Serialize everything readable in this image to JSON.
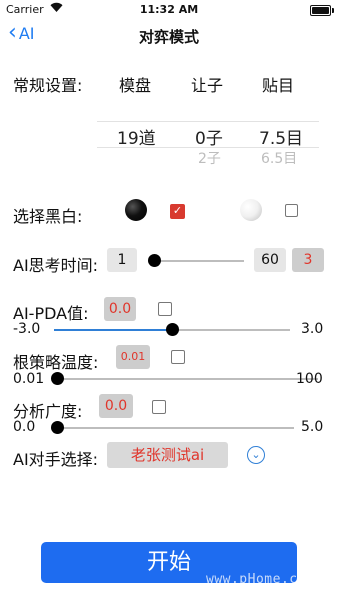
{
  "status_bar": {
    "carrier": "Carrier",
    "time": "11:32 AM"
  },
  "nav": {
    "back_label": "AI",
    "title": "对弈模式"
  },
  "general": {
    "label": "常规设置:",
    "headers": [
      "模盘",
      "让子",
      "贴目"
    ],
    "selected": [
      "19道",
      "0子",
      "7.5目"
    ],
    "next": [
      "2子",
      "6.5目"
    ]
  },
  "color_select": {
    "label": "选择黑白:",
    "black_checked": true,
    "white_checked": false
  },
  "think_time": {
    "label": "AI思考时间:",
    "min": "1",
    "max": "60",
    "value": "3",
    "fraction": 0.0
  },
  "pda": {
    "label": "AI-PDA值:",
    "value": "0.0",
    "min": "-3.0",
    "max": "3.0",
    "fraction": 0.5
  },
  "policy_temp": {
    "label": "根策略温度:",
    "value": "0.01",
    "min": "0.01",
    "max": "100",
    "fraction": 0.0
  },
  "breadth": {
    "label": "分析广度:",
    "value": "0.0",
    "min": "0.0",
    "max": "5.0",
    "fraction": 0.0
  },
  "opponent": {
    "label": "AI对手选择:",
    "value": "老张测试ai"
  },
  "start_button": "开始",
  "watermark": "www.pHome.com",
  "colors": {
    "accent": "#1e7cf2",
    "red": "#e0352b",
    "slider_fill": "#2f7fd6"
  }
}
